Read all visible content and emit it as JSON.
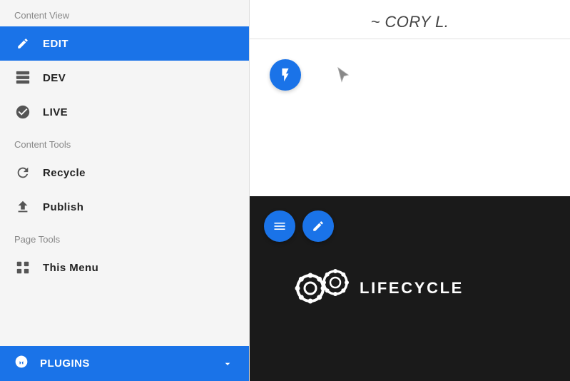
{
  "sidebar": {
    "content_view_label": "Content View",
    "items": [
      {
        "id": "edit",
        "label": "EDIT",
        "active": true
      },
      {
        "id": "dev",
        "label": "DEV",
        "active": false
      },
      {
        "id": "live",
        "label": "LIVE",
        "active": false
      }
    ],
    "content_tools_label": "Content Tools",
    "tool_items": [
      {
        "id": "recycle",
        "label": "Recycle"
      },
      {
        "id": "publish",
        "label": "Publish"
      }
    ],
    "page_tools_label": "Page Tools",
    "page_items": [
      {
        "id": "this-menu",
        "label": "This Menu"
      }
    ],
    "plugins_label": "PLUGINS"
  },
  "header": {
    "title": "~ CORY L."
  },
  "preview": {
    "lifecycle_text": "LIFECYCLE"
  },
  "colors": {
    "blue": "#1a73e8",
    "dark_bg": "#1a1a1a",
    "sidebar_bg": "#f5f5f5"
  }
}
